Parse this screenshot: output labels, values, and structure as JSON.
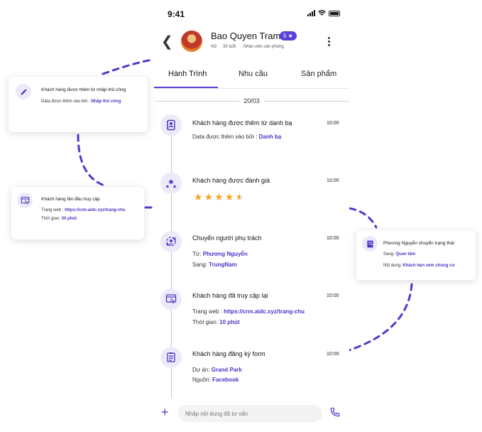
{
  "status_bar": {
    "time": "9:41"
  },
  "header": {
    "name": "Bao Quyen Tram",
    "badge": "5 ★",
    "gender": "Nữ",
    "age": "30 tuổi",
    "occupation": "Nhân viên văn phòng"
  },
  "tabs": [
    {
      "label": "Hành Trình",
      "active": true
    },
    {
      "label": "Nhu cầu",
      "active": false
    },
    {
      "label": "Sản phẩm",
      "active": false
    }
  ],
  "date_separator": "20/03",
  "events": [
    {
      "icon": "address-book-icon",
      "title": "Khách hàng được thêm từ danh bạ",
      "time": "10:00",
      "lines": [
        {
          "label": "Data được thêm vào bởi : ",
          "value": "Danh bạ"
        }
      ]
    },
    {
      "icon": "rating-stars-icon",
      "title": "Khách hàng được đánh giá",
      "time": "10:00",
      "rating": 4.5,
      "rating_max": 5
    },
    {
      "icon": "transfer-person-icon",
      "title": "Chuyển người phụ trách",
      "time": "10:00",
      "lines": [
        {
          "label": "Từ: ",
          "value": "Phương Nguyễn"
        },
        {
          "label": "Sang: ",
          "value": "TrungNam"
        }
      ]
    },
    {
      "icon": "web-click-icon",
      "title": "Khách hàng đã truy cập lại",
      "time": "10:00",
      "lines": [
        {
          "label": "Trang web : ",
          "value": "https://crm.aidc.xyz/trang-chu"
        },
        {
          "label": "Thời gian: ",
          "value": "10 phút"
        }
      ]
    },
    {
      "icon": "form-icon",
      "title": "Khách hàng đăng ký form",
      "time": "10:00",
      "lines": [
        {
          "label": "Dự án: ",
          "value": "Grand Park"
        },
        {
          "label": "Nguồn: ",
          "value": "Facebook"
        }
      ]
    }
  ],
  "composer": {
    "placeholder": "Nhập nội dung đã tư vấn"
  },
  "cards": {
    "manual": {
      "title": "Khách hàng được thêm từ nhập thủ công",
      "label": "Data được thêm vào bởi : ",
      "value": "Nhập thủ công"
    },
    "first_visit": {
      "title": "Khách hàng lần đầu truy cập",
      "label1": "Trang web : ",
      "value1": "https://crm.aidc.xyz/trang-chu",
      "label2": "Thời gian: ",
      "value2": "30 phút"
    },
    "status_change": {
      "title": "Phương Nguyễn chuyển trạng thái:",
      "label1": "Sang: ",
      "value1": "Quan tâm",
      "label2": "Nội dung: ",
      "value2": "Khách hẹn xem chung cư"
    }
  },
  "colors": {
    "accent": "#5b3fd6",
    "link": "#4a35c7",
    "star": "#f5a623",
    "dash": "#4b3ccf"
  }
}
